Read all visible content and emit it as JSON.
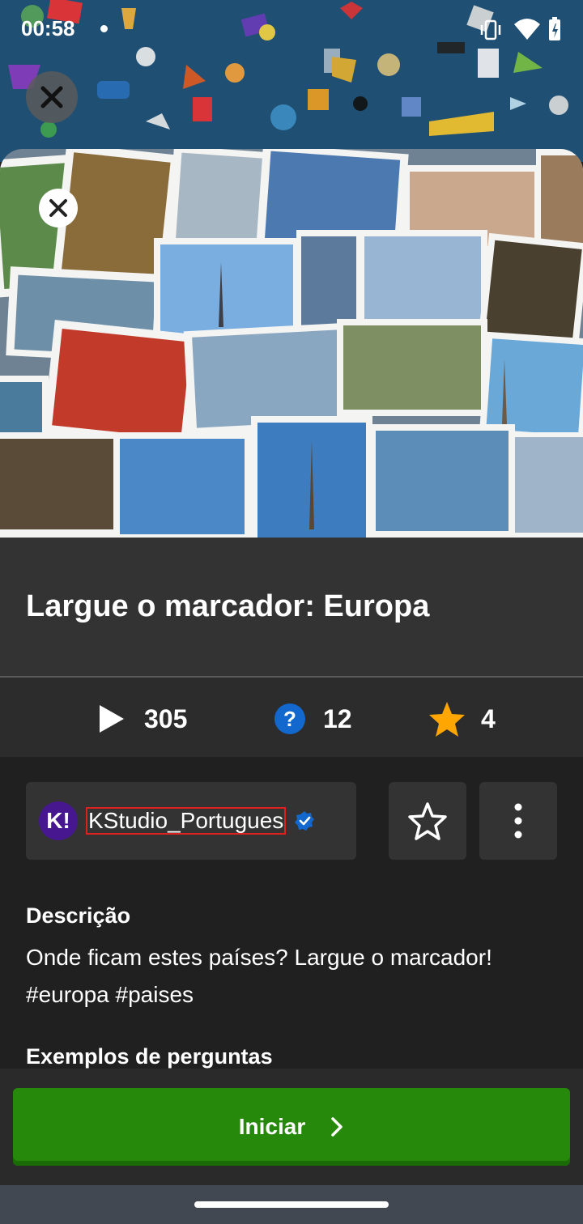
{
  "status_bar": {
    "time": "00:58"
  },
  "quiz": {
    "title": "Largue o marcador: Europa",
    "plays": "305",
    "questions": "12",
    "favorites": "4"
  },
  "author": {
    "avatar_text": "K!",
    "name": "KStudio_Portugues"
  },
  "description": {
    "heading": "Descrição",
    "text": "Onde ficam estes países? Largue o marcador! #europa #paises"
  },
  "examples": {
    "heading": "Exemplos de perguntas"
  },
  "actions": {
    "start_label": "Iniciar"
  },
  "colors": {
    "start": "#26890c",
    "accent_blue": "#1368ce",
    "star": "#ffa602",
    "brand": "#46178f"
  }
}
